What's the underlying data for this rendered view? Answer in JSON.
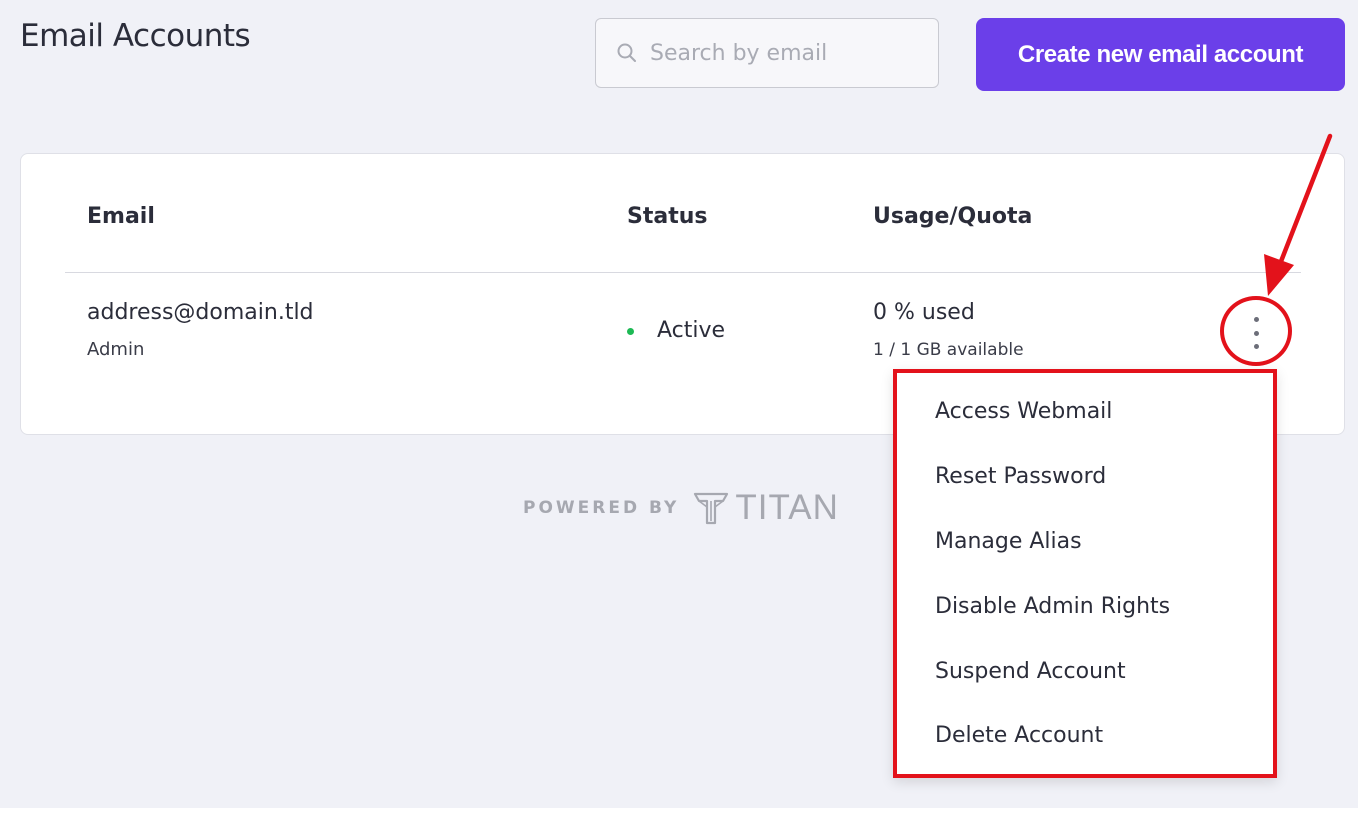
{
  "header": {
    "title": "Email Accounts",
    "search_placeholder": "Search by email",
    "create_button_label": "Create new email account"
  },
  "table": {
    "columns": [
      "Email",
      "Status",
      "Usage/Quota"
    ],
    "rows": [
      {
        "email": "address@domain.tld",
        "role": "Admin",
        "status": "Active",
        "usage": "0 % used",
        "quota": "1 / 1 GB available"
      }
    ]
  },
  "row_menu": {
    "items": [
      "Access Webmail",
      "Reset Password",
      "Manage Alias",
      "Disable Admin Rights",
      "Suspend Account",
      "Delete Account"
    ]
  },
  "footer": {
    "powered_by": "POWERED BY",
    "brand": "TITAN"
  },
  "colors": {
    "background": "#f0f1f7",
    "accent": "#6b3fe9",
    "status_active": "#1db954",
    "annotation": "#e3121b"
  },
  "icons": {
    "search": "search-icon",
    "row_actions": "more-vertical-icon",
    "logo": "titan-logo-icon"
  }
}
